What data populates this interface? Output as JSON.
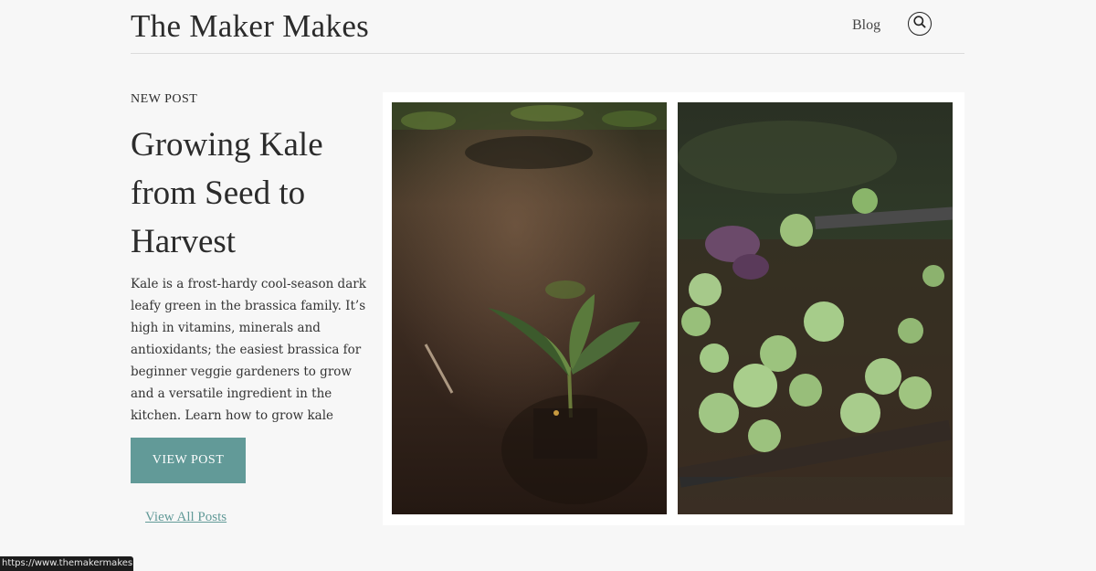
{
  "header": {
    "site_title": "The Maker Makes",
    "nav": [
      {
        "label": "Blog"
      }
    ],
    "search_icon": "search-icon"
  },
  "hero": {
    "eyebrow": "NEW POST",
    "title": "Growing Kale from Seed to Harvest",
    "excerpt": "Kale is a frost-hardy cool-season dark leafy green in the brassica family. It’s high in vitamins, minerals and antioxidants; the easiest brassica for beginner veggie gardeners to grow and a versatile ingredient in the kitchen. Learn how to grow kale",
    "cta_label": "VIEW POST",
    "all_posts_label": "View All Posts"
  },
  "images": [
    {
      "name": "kale-seedling-in-soil-photo"
    },
    {
      "name": "raised-bed-seedlings-photo"
    }
  ],
  "status_bar": {
    "url": "https://www.themakermakes.com"
  },
  "colors": {
    "accent": "#629a98",
    "background": "#f7f7f7",
    "text": "#2b2b2b"
  }
}
